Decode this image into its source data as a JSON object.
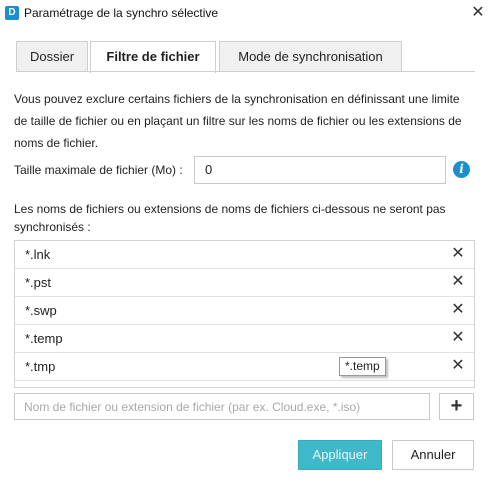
{
  "window": {
    "app_icon_letter": "D",
    "title": "Paramétrage de la synchro sélective",
    "close_glyph": "✕"
  },
  "tabs": [
    {
      "label": "Dossier",
      "active": false
    },
    {
      "label": "Filtre de fichier",
      "active": true
    },
    {
      "label": "Mode de synchronisation",
      "active": false
    }
  ],
  "description": "Vous pouvez exclure certains fichiers de la synchronisation en définissant une limite de taille de fichier ou en plaçant un filtre sur les noms de fichier ou les extensions de noms de fichier.",
  "size_limit": {
    "label": "Taille maximale de fichier (Mo) :",
    "value": "0",
    "info_icon": "info-icon"
  },
  "list_description": "Les noms de fichiers ou extensions de noms de fichiers ci-dessous ne seront pas synchronisés :",
  "excluded_items": [
    {
      "label": "*.lnk"
    },
    {
      "label": "*.pst"
    },
    {
      "label": "*.swp"
    },
    {
      "label": "*.temp"
    },
    {
      "label": "*.tmp"
    }
  ],
  "remove_glyph": "✕",
  "tooltip": "*.temp",
  "add_field": {
    "placeholder": "Nom de fichier ou extension de fichier (par ex. Cloud.exe, *.iso)",
    "value": ""
  },
  "add_button": "+",
  "buttons": {
    "apply": "Appliquer",
    "cancel": "Annuler"
  },
  "colors": {
    "accent": "#1c8fd0",
    "apply_button": "#3fb9c9"
  }
}
